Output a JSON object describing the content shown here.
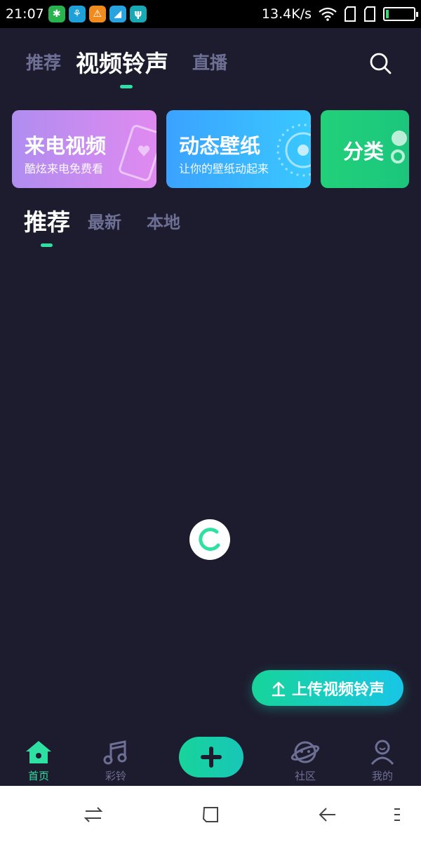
{
  "status_bar": {
    "time": "21:07",
    "net_speed": "13.4K/s",
    "battery_level": 0.1
  },
  "top_tabs": [
    {
      "label": "推荐",
      "active": false
    },
    {
      "label": "视频铃声",
      "active": true
    },
    {
      "label": "直播",
      "active": false
    }
  ],
  "banners": [
    {
      "title": "来电视频",
      "subtitle": "酷炫来电免费看"
    },
    {
      "title": "动态壁纸",
      "subtitle": "让你的壁纸动起来"
    },
    {
      "title": "分类",
      "subtitle": ""
    }
  ],
  "sub_tabs": [
    {
      "label": "推荐",
      "active": true
    },
    {
      "label": "最新",
      "active": false
    },
    {
      "label": "本地",
      "active": false
    }
  ],
  "upload_button": {
    "label": "上传视频铃声"
  },
  "bottom_nav": [
    {
      "label": "首页",
      "icon": "home-icon",
      "active": true
    },
    {
      "label": "彩铃",
      "icon": "music-note-icon",
      "active": false
    },
    {
      "label": "社区",
      "icon": "planet-icon",
      "active": false
    },
    {
      "label": "我的",
      "icon": "person-icon",
      "active": false
    }
  ],
  "colors": {
    "background": "#1d1c2e",
    "accent": "#2ee0a1",
    "inactive_text": "#6e6f95"
  }
}
